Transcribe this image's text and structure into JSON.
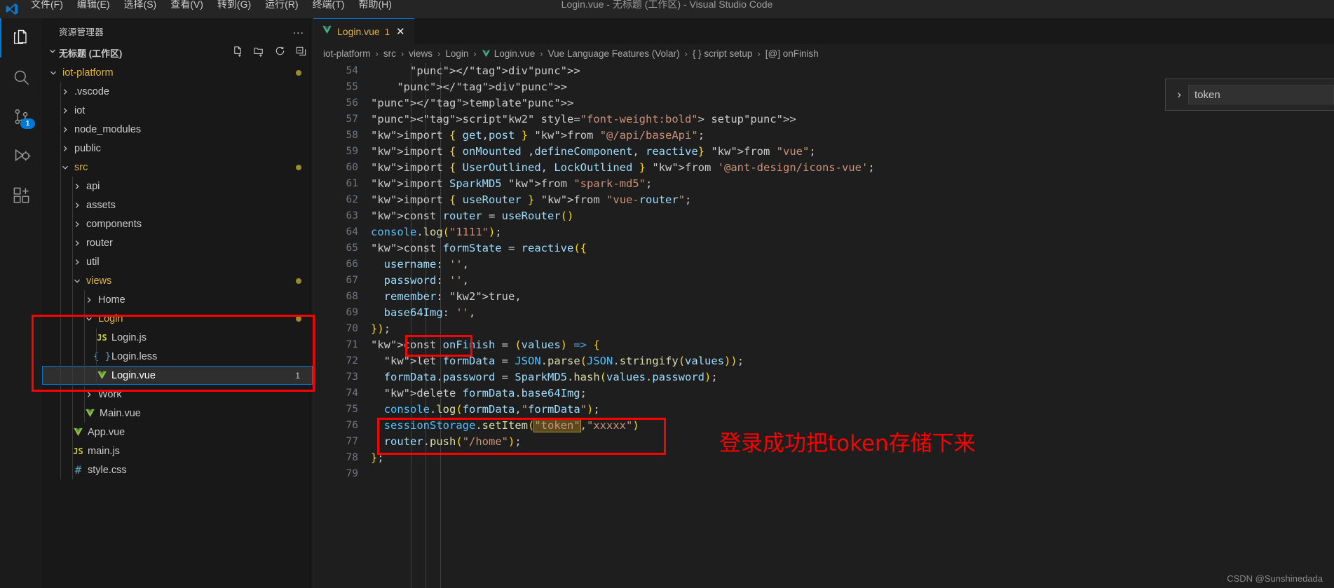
{
  "window": {
    "title": "Login.vue - 无标题 (工作区) - Visual Studio Code",
    "logo_icon": "vscode-logo-icon"
  },
  "menubar": [
    {
      "label": "文件(F)"
    },
    {
      "label": "编辑(E)"
    },
    {
      "label": "选择(S)"
    },
    {
      "label": "查看(V)"
    },
    {
      "label": "转到(G)"
    },
    {
      "label": "运行(R)"
    },
    {
      "label": "终端(T)"
    },
    {
      "label": "帮助(H)"
    }
  ],
  "activitybar": [
    {
      "name": "explorer",
      "icon": "files-icon",
      "active": true,
      "badge": ""
    },
    {
      "name": "search",
      "icon": "search-icon",
      "active": false,
      "badge": ""
    },
    {
      "name": "source-control",
      "icon": "source-control-icon",
      "active": false,
      "badge": "1"
    },
    {
      "name": "run-debug",
      "icon": "run-and-debug-icon",
      "active": false,
      "badge": ""
    },
    {
      "name": "extensions",
      "icon": "extensions-icon",
      "active": false,
      "badge": ""
    }
  ],
  "sidebar": {
    "title": "资源管理器",
    "more_actions": "...",
    "workspace": {
      "name": "无标题 (工作区)",
      "actions": [
        "new-file-icon",
        "new-folder-icon",
        "refresh-icon",
        "collapse-all-icon"
      ]
    },
    "tree": [
      {
        "label": "iot-platform",
        "type": "folder",
        "open": true,
        "depth": 1,
        "dot": true
      },
      {
        "label": ".vscode",
        "type": "folder",
        "open": false,
        "depth": 2
      },
      {
        "label": "iot",
        "type": "folder",
        "open": false,
        "depth": 2
      },
      {
        "label": "node_modules",
        "type": "folder",
        "open": false,
        "depth": 2
      },
      {
        "label": "public",
        "type": "folder",
        "open": false,
        "depth": 2
      },
      {
        "label": "src",
        "type": "folder",
        "open": true,
        "depth": 2,
        "dot": true
      },
      {
        "label": "api",
        "type": "folder",
        "open": false,
        "depth": 3
      },
      {
        "label": "assets",
        "type": "folder",
        "open": false,
        "depth": 3
      },
      {
        "label": "components",
        "type": "folder",
        "open": false,
        "depth": 3
      },
      {
        "label": "router",
        "type": "folder",
        "open": false,
        "depth": 3
      },
      {
        "label": "util",
        "type": "folder",
        "open": false,
        "depth": 3
      },
      {
        "label": "views",
        "type": "folder",
        "open": true,
        "depth": 3,
        "dot": true
      },
      {
        "label": "Home",
        "type": "folder",
        "open": false,
        "depth": 4
      },
      {
        "label": "Login",
        "type": "folder",
        "open": true,
        "depth": 4,
        "dot": true
      },
      {
        "label": "Login.js",
        "type": "file",
        "icon": "js-icon",
        "depth": 5
      },
      {
        "label": "Login.less",
        "type": "file",
        "icon": "less-icon",
        "depth": 5
      },
      {
        "label": "Login.vue",
        "type": "file",
        "icon": "vue-icon",
        "depth": 5,
        "selected": true,
        "count": "1"
      },
      {
        "label": "Work",
        "type": "folder",
        "open": false,
        "depth": 4
      },
      {
        "label": "Main.vue",
        "type": "file",
        "icon": "vue-icon",
        "depth": 4
      },
      {
        "label": "App.vue",
        "type": "file",
        "icon": "vue-icon",
        "depth": 3
      },
      {
        "label": "main.js",
        "type": "file",
        "icon": "js-icon",
        "depth": 3
      },
      {
        "label": "style.css",
        "type": "file",
        "icon": "css-icon",
        "depth": 3
      }
    ]
  },
  "editor": {
    "tab": {
      "icon": "vue-icon",
      "name": "Login.vue",
      "problem_count": "1",
      "close": "✕"
    },
    "breadcrumb": [
      {
        "label": "iot-platform"
      },
      {
        "label": "src"
      },
      {
        "label": "views"
      },
      {
        "label": "Login"
      },
      {
        "label": "Login.vue",
        "icon": "vue-icon"
      },
      {
        "label": "Vue Language Features (Volar)"
      },
      {
        "label": "{ } script setup"
      },
      {
        "label": "[@] onFinish"
      }
    ],
    "first_line": "54",
    "lines": [
      {
        "n": "54",
        "text": "      </div>"
      },
      {
        "n": "55",
        "text": "    </div>"
      },
      {
        "n": "56",
        "text": "</template>"
      },
      {
        "n": "57",
        "text": "<script setup>"
      },
      {
        "n": "58",
        "text": "import { get,post } from \"@/api/baseApi\";"
      },
      {
        "n": "59",
        "text": "import { onMounted ,defineComponent, reactive} from \"vue\";"
      },
      {
        "n": "60",
        "text": "import { UserOutlined, LockOutlined } from '@ant-design/icons-vue';"
      },
      {
        "n": "61",
        "text": "import SparkMD5 from \"spark-md5\";"
      },
      {
        "n": "62",
        "text": "import { useRouter } from \"vue-router\";"
      },
      {
        "n": "63",
        "text": "const router = useRouter()"
      },
      {
        "n": "64",
        "text": "console.log(\"1111\");"
      },
      {
        "n": "65",
        "text": "const formState = reactive({"
      },
      {
        "n": "66",
        "text": "  username: '',"
      },
      {
        "n": "67",
        "text": "  password: '',"
      },
      {
        "n": "68",
        "text": "  remember: true,"
      },
      {
        "n": "69",
        "text": "  base64Img: '',"
      },
      {
        "n": "70",
        "text": "});"
      },
      {
        "n": "71",
        "text": "const onFinish = (values) => {"
      },
      {
        "n": "72",
        "text": "  let formData = JSON.parse(JSON.stringify(values));"
      },
      {
        "n": "73",
        "text": "  formData.password = SparkMD5.hash(values.password);"
      },
      {
        "n": "74",
        "text": "  delete formData.base64Img;"
      },
      {
        "n": "75",
        "text": "  console.log(formData,\"formData\");"
      },
      {
        "n": "76",
        "text": "  sessionStorage.setItem(\"token\",\"xxxxx\")"
      },
      {
        "n": "77",
        "text": "  router.push(\"/home\");"
      },
      {
        "n": "78",
        "text": "};"
      },
      {
        "n": "79",
        "text": ""
      }
    ]
  },
  "find_widget": {
    "chevron": "›",
    "value": "token"
  },
  "annotations": {
    "note_text": "登录成功把token存储下来",
    "note_color": "#ff0000"
  },
  "watermark": "CSDN @Sunshinedada"
}
